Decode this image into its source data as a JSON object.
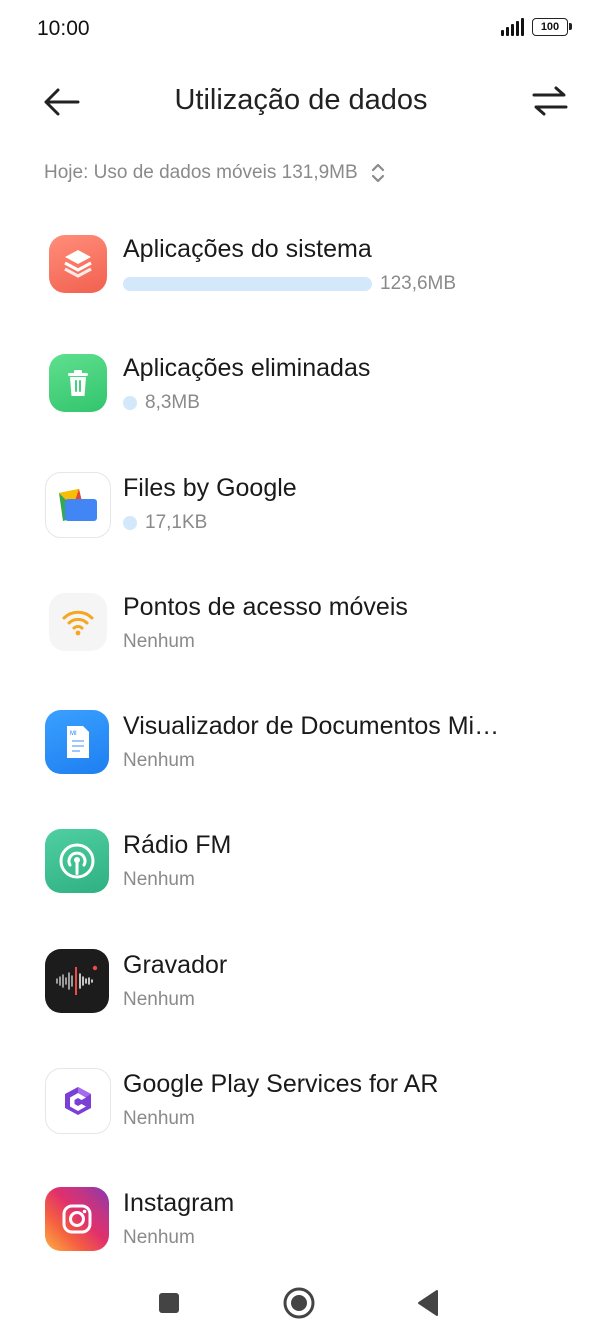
{
  "status": {
    "time": "10:00",
    "battery": "100"
  },
  "header": {
    "title": "Utilização de dados",
    "back_icon": "arrow-left-icon",
    "sort_icon": "swap-arrows-icon"
  },
  "summary": {
    "text": "Hoje: Uso de dados móveis 131,9MB",
    "icon": "chevron-up-down-icon"
  },
  "colors": {
    "usage_bar": "#d3e8fb",
    "secondary_text": "#8a8a8a"
  },
  "apps": [
    {
      "name": "Aplicações do sistema",
      "usage": "123,6MB",
      "usage_fraction": 0.937,
      "icon": "system-apps-icon"
    },
    {
      "name": "Aplicações eliminadas",
      "usage": "8,3MB",
      "usage_fraction": 0.063,
      "icon": "trash-icon"
    },
    {
      "name": "Files by Google",
      "usage": "17,1KB",
      "usage_fraction": 0.0001,
      "icon": "files-by-google-icon"
    },
    {
      "name": "Pontos de acesso móveis",
      "usage": "Nenhum",
      "usage_fraction": 0,
      "icon": "wifi-hotspot-icon"
    },
    {
      "name": "Visualizador de Documentos Mi…",
      "usage": "Nenhum",
      "usage_fraction": 0,
      "icon": "document-viewer-icon"
    },
    {
      "name": "Rádio FM",
      "usage": "Nenhum",
      "usage_fraction": 0,
      "icon": "fm-radio-icon"
    },
    {
      "name": "Gravador",
      "usage": "Nenhum",
      "usage_fraction": 0,
      "icon": "recorder-icon"
    },
    {
      "name": "Google Play Services for AR",
      "usage": "Nenhum",
      "usage_fraction": 0,
      "icon": "arcore-icon"
    },
    {
      "name": "Instagram",
      "usage": "Nenhum",
      "usage_fraction": 0,
      "icon": "instagram-icon"
    }
  ],
  "nav": {
    "recents_icon": "square-icon",
    "home_icon": "circle-home-icon",
    "back_icon": "triangle-back-icon"
  }
}
